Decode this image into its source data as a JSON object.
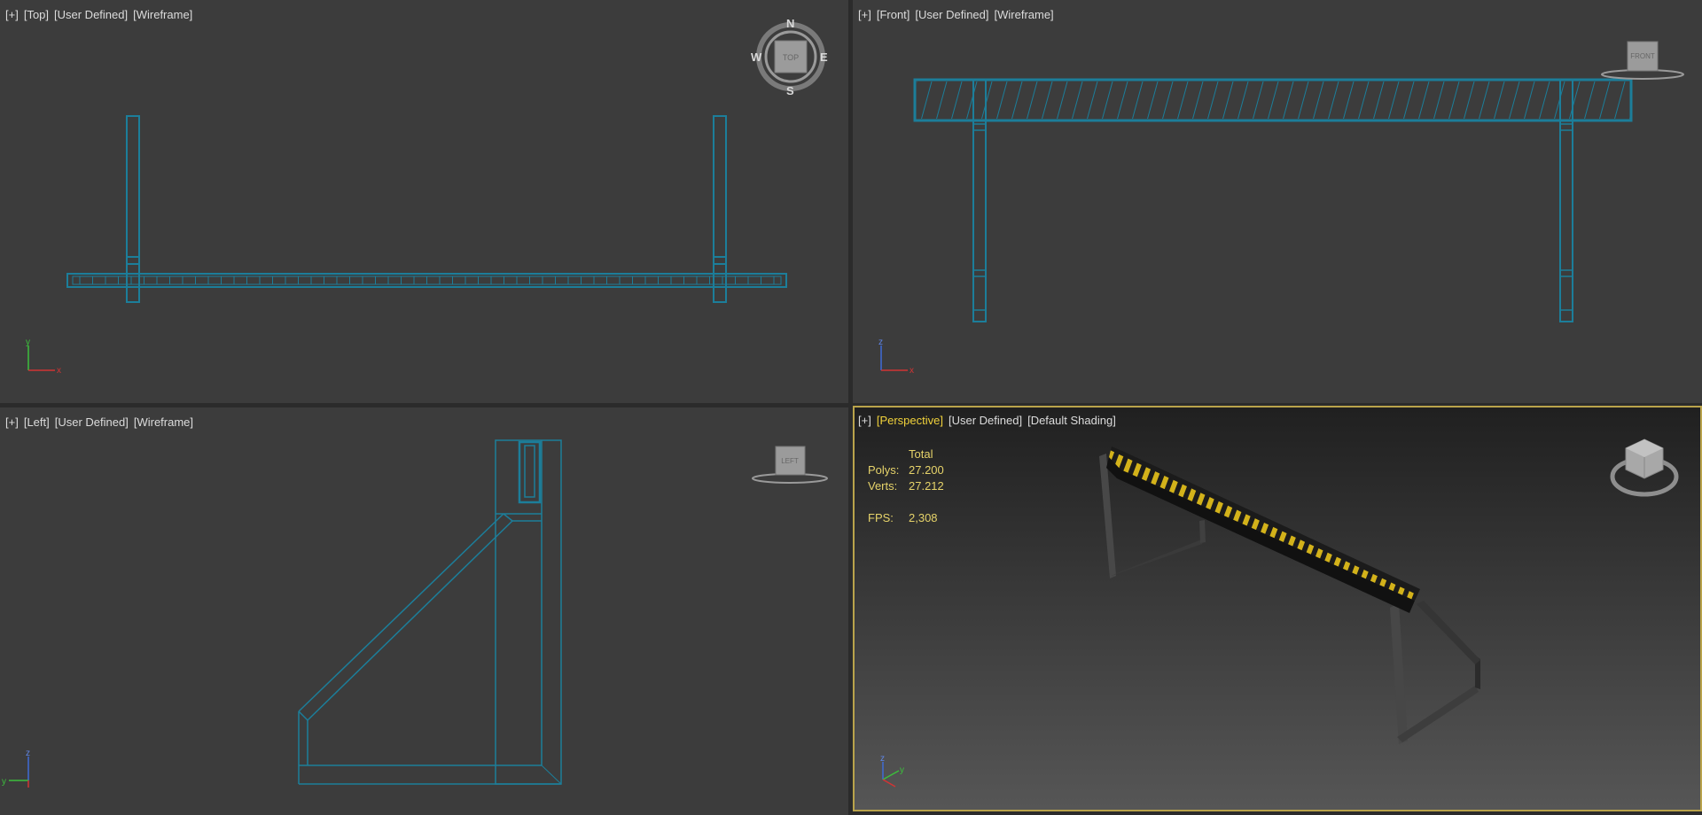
{
  "viewports": {
    "top": {
      "labels": [
        "[+]",
        "[Top]",
        "[User Defined]",
        "[Wireframe]"
      ],
      "cube_label": "TOP",
      "compass": {
        "n": "N",
        "s": "S",
        "e": "E",
        "w": "W"
      },
      "axis": {
        "up": "y",
        "right": "x"
      }
    },
    "front": {
      "labels": [
        "[+]",
        "[Front]",
        "[User Defined]",
        "[Wireframe]"
      ],
      "cube_label": "FRONT",
      "axis": {
        "up": "z",
        "right": "x"
      }
    },
    "left": {
      "labels": [
        "[+]",
        "[Left]",
        "[User Defined]",
        "[Wireframe]"
      ],
      "cube_label": "LEFT",
      "axis": {
        "up": "z",
        "right": "y"
      }
    },
    "perspective": {
      "labels": [
        "[+]",
        "[Perspective]",
        "[User Defined]",
        "[Default Shading]"
      ],
      "axis": {
        "up": "z",
        "right": "y"
      },
      "stats": {
        "header": "Total",
        "polys_label": "Polys:",
        "polys_value": "27.200",
        "verts_label": "Verts:",
        "verts_value": "27.212",
        "fps_label": "FPS:",
        "fps_value": "2,308"
      }
    }
  },
  "colors": {
    "wire": "#1c7e9a",
    "viewport_bg": "#3c3c3c",
    "active_border": "#b9a34b",
    "stripe_yellow": "#d3b21a",
    "stripe_black": "#1b1b1b"
  }
}
